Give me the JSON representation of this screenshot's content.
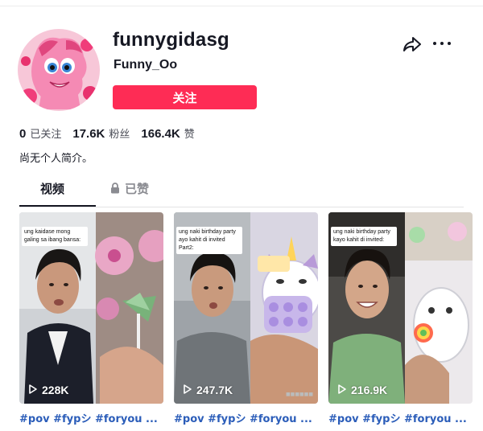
{
  "profile": {
    "username": "funnygidasg",
    "nickname": "Funny_Oo",
    "follow_label": "关注",
    "bio": "尚无个人简介。"
  },
  "icons": {
    "share": "share-arrow-icon",
    "more": "more-horizontal-icon",
    "lock": "lock-icon",
    "play": "play-icon"
  },
  "stats": [
    {
      "value": "0",
      "label": "已关注"
    },
    {
      "value": "17.6K",
      "label": "粉丝"
    },
    {
      "value": "166.4K",
      "label": "赞"
    }
  ],
  "tabs": [
    {
      "label": "视频",
      "active": true
    },
    {
      "label": "已赞",
      "locked": true
    }
  ],
  "videos": [
    {
      "views": "228K",
      "caption": "#pov #fypシ #foryou ...",
      "overlay": "ung kaidase mong galing sa ibang bansa:"
    },
    {
      "views": "247.7K",
      "caption": "#pov #fypシ #foryou ...",
      "overlay": "ung naki birthday party ayo kahit di invited Part2:"
    },
    {
      "views": "216.9K",
      "caption": "#pov #fypシ #foryou ...",
      "overlay": "ung naki birthday party kayo kahit di invited:"
    }
  ],
  "colors": {
    "accent": "#fe2c55",
    "text": "#161823",
    "muted": "#8a8b91",
    "hashtag": "#2b5db9"
  }
}
